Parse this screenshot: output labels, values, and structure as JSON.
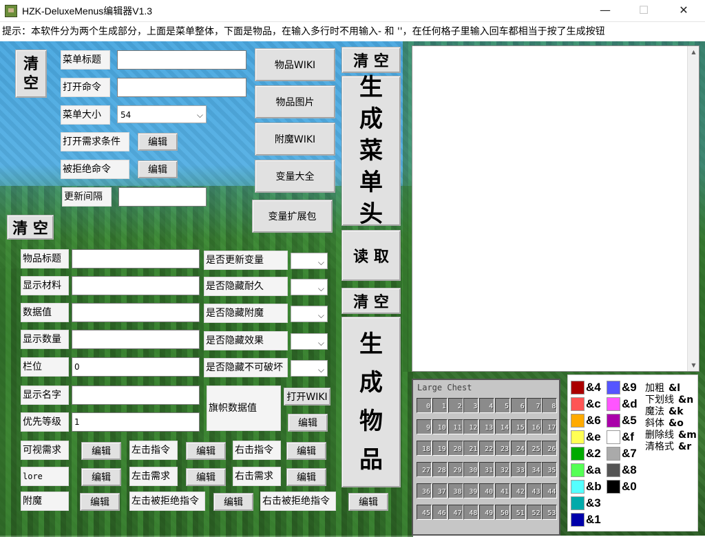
{
  "window": {
    "title": "HZK-DeluxeMenus编辑器V1.3",
    "minimize": "—",
    "maximize": "☐",
    "close": "✕"
  },
  "hint": "提示：本软件分为两个生成部分，上面是菜单整体，下面是物品，在输入多行时不用输入- 和 ''，在任何格子里输入回车都相当于按了生成按钮",
  "menu_section": {
    "clear": "清\n空",
    "title_label": "菜单标题",
    "title_value": "",
    "open_cmd_label": "打开命令",
    "open_cmd_value": "",
    "size_label": "菜单大小",
    "size_value": "54",
    "open_req_label": "打开需求条件",
    "open_req_edit": "编辑",
    "deny_cmd_label": "被拒绝命令",
    "deny_cmd_edit": "编辑",
    "update_label": "更新间隔",
    "update_value": ""
  },
  "links": {
    "item_wiki": "物品WIKI",
    "item_images": "物品图片",
    "enchant_wiki": "附魔WIKI",
    "variables": "变量大全",
    "var_expansion": "变量扩展包"
  },
  "right_buttons": {
    "clear_top": "清 空",
    "gen_header": [
      "生",
      "成",
      "菜",
      "单",
      "头"
    ],
    "read": "读 取",
    "clear_bottom": "清 空",
    "gen_item": [
      "生",
      "成",
      "物",
      "品"
    ]
  },
  "item_section": {
    "clear": "清 空",
    "fields": [
      {
        "label": "物品标题",
        "value": ""
      },
      {
        "label": "显示材料",
        "value": ""
      },
      {
        "label": "数据值",
        "value": ""
      },
      {
        "label": "显示数量",
        "value": ""
      },
      {
        "label": "栏位",
        "value": "0"
      },
      {
        "label": "显示名字",
        "value": ""
      },
      {
        "label": "优先等级",
        "value": "1"
      }
    ],
    "flags": [
      {
        "label": "是否更新变量",
        "value": ""
      },
      {
        "label": "是否隐藏耐久",
        "value": ""
      },
      {
        "label": "是否隐藏附魔",
        "value": ""
      },
      {
        "label": "是否隐藏效果",
        "value": ""
      },
      {
        "label": "是否隐藏不可破坏",
        "value": ""
      }
    ],
    "banner_label": "旗帜数据值",
    "open_wiki": "打开WIKI",
    "banner_edit": "编辑",
    "actions": [
      {
        "label": "可视需求",
        "edit": "编辑"
      },
      {
        "label": "lore",
        "edit": "编辑"
      },
      {
        "label": "附魔",
        "edit": "编辑"
      },
      {
        "label": "左击指令",
        "edit": "编辑"
      },
      {
        "label": "左击需求",
        "edit": "编辑"
      },
      {
        "label": "左击被拒绝指令",
        "edit": "编辑"
      },
      {
        "label": "右击指令",
        "edit": "编辑"
      },
      {
        "label": "右击需求",
        "edit": "编辑"
      },
      {
        "label": "右击被拒绝指令",
        "edit": "编辑"
      }
    ]
  },
  "output": {
    "text": "",
    "scroll_up": "▲",
    "scroll_down": "▼"
  },
  "chest": {
    "title": "Large Chest",
    "slots": [
      "0",
      "1",
      "2",
      "3",
      "4",
      "5",
      "6",
      "7",
      "8",
      "9",
      "10",
      "11",
      "12",
      "13",
      "14",
      "15",
      "16",
      "17",
      "18",
      "19",
      "20",
      "21",
      "22",
      "23",
      "24",
      "25",
      "26",
      "27",
      "28",
      "29",
      "30",
      "31",
      "32",
      "33",
      "34",
      "35",
      "36",
      "37",
      "38",
      "39",
      "40",
      "41",
      "42",
      "43",
      "44",
      "45",
      "46",
      "47",
      "48",
      "49",
      "50",
      "51",
      "52",
      "53"
    ]
  },
  "legend": {
    "col1": [
      {
        "code": "&4",
        "color": "#aa0000"
      },
      {
        "code": "&c",
        "color": "#ff5555"
      },
      {
        "code": "&6",
        "color": "#ffaa00"
      },
      {
        "code": "&e",
        "color": "#ffff55"
      },
      {
        "code": "&2",
        "color": "#00aa00"
      },
      {
        "code": "&a",
        "color": "#55ff55"
      },
      {
        "code": "&b",
        "color": "#55ffff"
      },
      {
        "code": "&3",
        "color": "#00aaaa"
      },
      {
        "code": "&1",
        "color": "#0000aa"
      }
    ],
    "col2": [
      {
        "code": "&9",
        "color": "#5555ff"
      },
      {
        "code": "&d",
        "color": "#ff55ff"
      },
      {
        "code": "&5",
        "color": "#aa00aa"
      },
      {
        "code": "&f",
        "color": "#ffffff"
      },
      {
        "code": "&7",
        "color": "#aaaaaa"
      },
      {
        "code": "&8",
        "color": "#555555"
      },
      {
        "code": "&0",
        "color": "#000000"
      }
    ],
    "formats": [
      {
        "name": "加粗",
        "code": "&l"
      },
      {
        "name": "下划线",
        "code": "&n"
      },
      {
        "name": "魔法",
        "code": "&k"
      },
      {
        "name": "斜体",
        "code": "&o"
      },
      {
        "name": "删除线",
        "code": "&m"
      },
      {
        "name": "清格式",
        "code": "&r"
      }
    ]
  }
}
